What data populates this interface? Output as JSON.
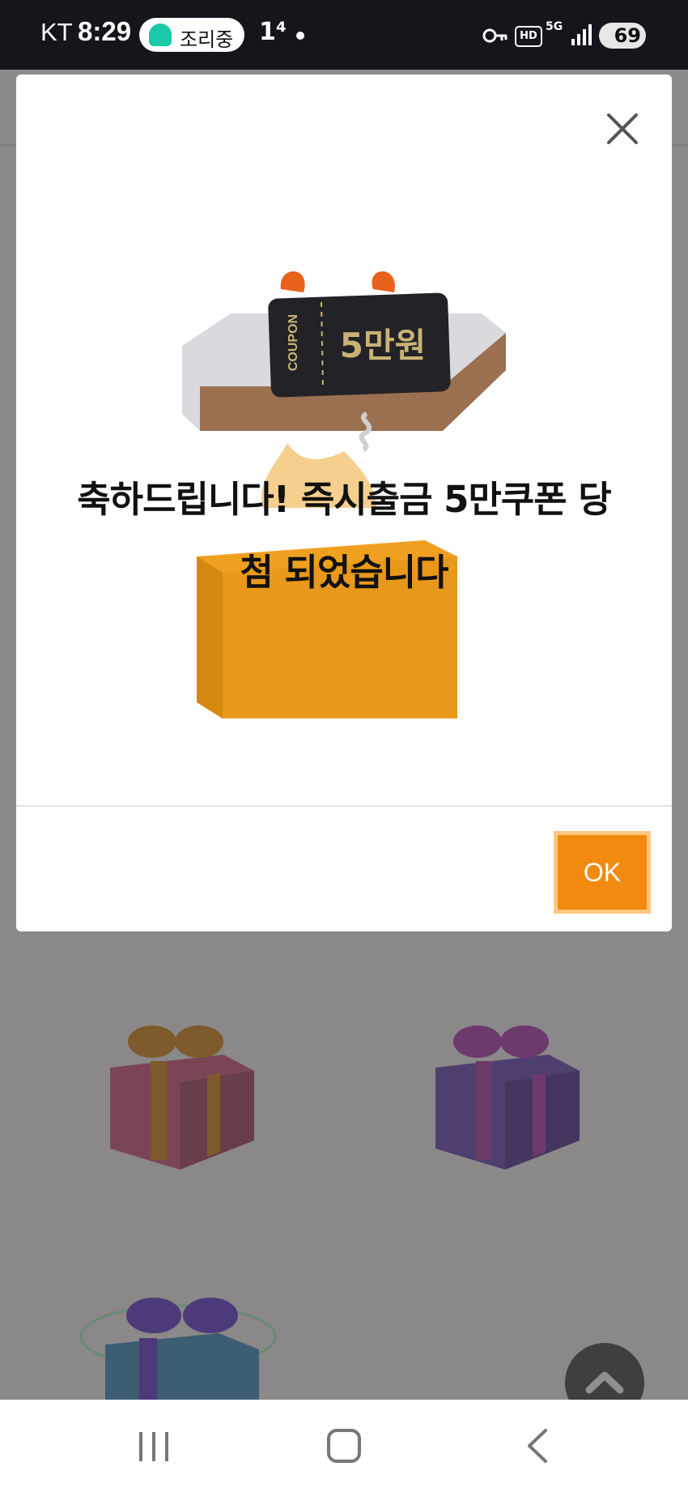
{
  "status_bar": {
    "carrier": "KT",
    "time": "8:29",
    "pill_label": "조리중",
    "extra": "1⁴",
    "battery": "69",
    "network": "5G",
    "hd": "HD"
  },
  "modal": {
    "coupon_label": "COUPON",
    "coupon_value": "5만원",
    "message_line1": "축하드립니다! 즉시출금 5만쿠폰 당",
    "message_line2": "첨 되었습니다",
    "ok_label": "OK"
  },
  "colors": {
    "accent": "#f28a0f",
    "overlay": "#8a8888",
    "statusbar": "#15151c"
  },
  "icons": [
    "close-icon",
    "chevron-up-icon",
    "recent-apps-icon",
    "home-icon",
    "back-icon",
    "key-icon",
    "signal-icon"
  ]
}
